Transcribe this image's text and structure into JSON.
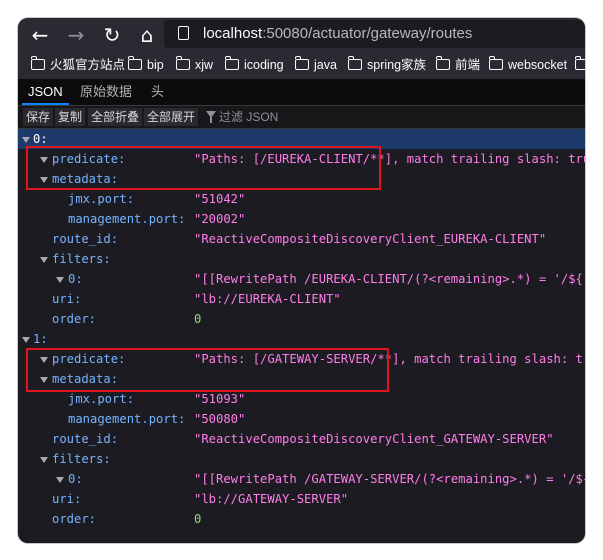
{
  "nav": {
    "back_icon": "←",
    "forward_icon": "→",
    "reload_icon": "↻",
    "home_icon": "⌂",
    "url_host": "localhost",
    "url_rest": ":50080/actuator/gateway/routes"
  },
  "bookmarks": [
    "火狐官方站点",
    "bip",
    "xjw",
    "icoding",
    "java",
    "spring家族",
    "前端",
    "websocket"
  ],
  "viewer_tabs": [
    "JSON",
    "原始数据",
    "头"
  ],
  "toolbar": {
    "save": "保存",
    "copy": "复制",
    "collapse_all": "全部折叠",
    "expand_all": "全部展开",
    "filter_placeholder": "过滤 JSON"
  },
  "rows": [
    {
      "key": "0:",
      "value": "",
      "type": "none"
    },
    {
      "key": "predicate:",
      "value": "\"Paths: [/EUREKA-CLIENT/**], match trailing slash: true\"",
      "type": "string"
    },
    {
      "key": "metadata:",
      "value": "",
      "type": "none"
    },
    {
      "key": "jmx.port:",
      "value": "\"51042\"",
      "type": "string"
    },
    {
      "key": "management.port:",
      "value": "\"20002\"",
      "type": "string"
    },
    {
      "key": "route_id:",
      "value": "\"ReactiveCompositeDiscoveryClient_EUREKA-CLIENT\"",
      "type": "string"
    },
    {
      "key": "filters:",
      "value": "",
      "type": "none"
    },
    {
      "key": "0:",
      "value": "\"[[RewritePath /EUREKA-CLIENT/(?<remaining>.*) = '/${remaining}']]\"",
      "type": "string"
    },
    {
      "key": "uri:",
      "value": "\"lb://EUREKA-CLIENT\"",
      "type": "string"
    },
    {
      "key": "order:",
      "value": "0",
      "type": "number"
    },
    {
      "key": "1:",
      "value": "",
      "type": "none"
    },
    {
      "key": "predicate:",
      "value": "\"Paths: [/GATEWAY-SERVER/**], match trailing slash: true\"",
      "type": "string"
    },
    {
      "key": "metadata:",
      "value": "",
      "type": "none"
    },
    {
      "key": "jmx.port:",
      "value": "\"51093\"",
      "type": "string"
    },
    {
      "key": "management.port:",
      "value": "\"50080\"",
      "type": "string"
    },
    {
      "key": "route_id:",
      "value": "\"ReactiveCompositeDiscoveryClient_GATEWAY-SERVER\"",
      "type": "string"
    },
    {
      "key": "filters:",
      "value": "",
      "type": "none"
    },
    {
      "key": "0:",
      "value": "\"[[RewritePath /GATEWAY-SERVER/(?<remaining>.*) = '/${remaining}']]\"",
      "type": "string"
    },
    {
      "key": "uri:",
      "value": "\"lb://GATEWAY-SERVER\"",
      "type": "string"
    },
    {
      "key": "order:",
      "value": "0",
      "type": "number"
    }
  ]
}
